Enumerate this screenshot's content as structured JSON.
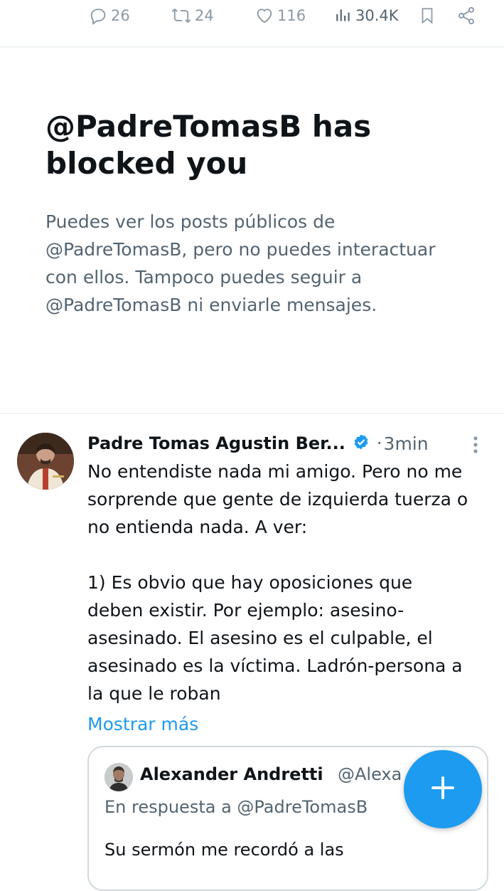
{
  "actions": {
    "replies": "26",
    "reposts": "24",
    "likes": "116",
    "views": "30.4K"
  },
  "blocked": {
    "title": "@PadreTomasB has blocked you",
    "description": "Puedes ver los posts públicos de @PadreTomasB, pero no puedes interactuar con ellos. Tampoco puedes seguir a @PadreTomasB ni enviarle mensajes."
  },
  "tweet": {
    "author": "Padre Tomas Agustin Ber...",
    "separator": "·",
    "time": "3min",
    "text": "No entendiste nada mi amigo. Pero no me sorprende que gente de izquierda tuerza o no entienda nada. A ver:\n\n1) Es obvio que hay oposiciones que deben existir. Por ejemplo: asesino-asesinado. El asesino es el culpable, el asesinado es la víctima. Ladrón-persona a la que le roban",
    "show_more": "Mostrar más",
    "quote": {
      "author": "Alexander Andretti",
      "handle": "@Alexa",
      "reply_to": "En respuesta a @PadreTomasB",
      "text": "Su sermón me recordó a las"
    }
  },
  "colors": {
    "accent": "#1d9bf0",
    "muted": "#536471",
    "border": "#cfd9de"
  },
  "icons": [
    "reply-icon",
    "repost-icon",
    "like-icon",
    "views-icon",
    "bookmark-icon",
    "share-icon",
    "verified-badge-icon",
    "more-options-icon",
    "compose-plus-icon"
  ]
}
